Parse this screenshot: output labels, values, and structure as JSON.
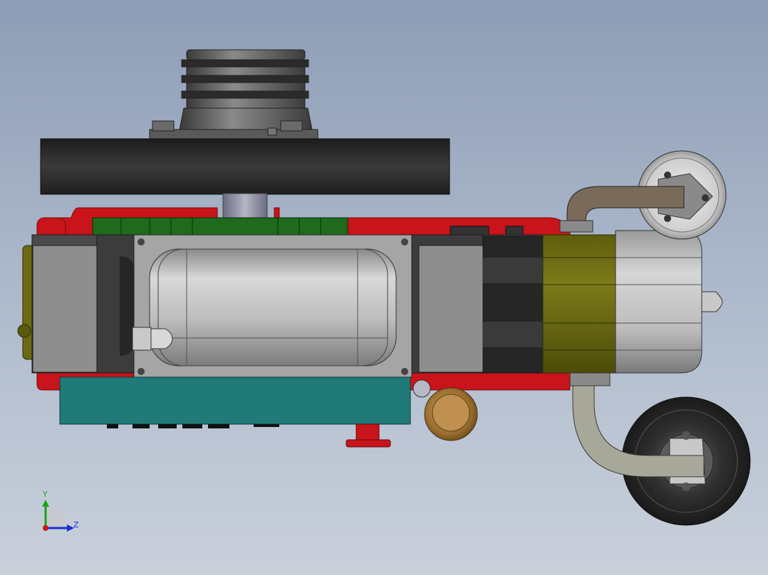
{
  "viewport": {
    "background_top": "#8e9db6",
    "background_bottom": "#c9d0db"
  },
  "colors": {
    "housing_red": "#c8141a",
    "fin_green": "#1f6a1c",
    "base_teal": "#1f7a78",
    "cover_gray": "#9b9b9b",
    "drum_silver": "#b9b9b9",
    "collar_olive": "#6b6a12",
    "pulley_black": "#2a2a2a",
    "pipe_brown": "#7a6a5a",
    "pipe_khaki": "#a8a89a",
    "knob_bronze": "#b88a4a"
  },
  "triad": {
    "y_label": "Y",
    "z_label": "Z",
    "y_color": "#1aa31a",
    "z_color": "#1a2fd6",
    "origin_color": "#c81a1a"
  }
}
